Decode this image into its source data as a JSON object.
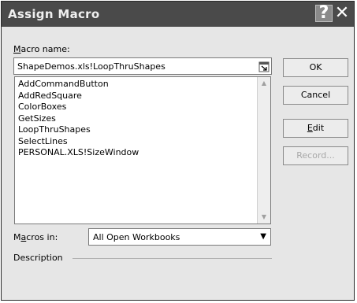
{
  "window": {
    "title": "Assign Macro",
    "help_glyph": "?",
    "close_glyph": "✕"
  },
  "macro_name": {
    "label_prefix": "M",
    "label_rest": "acro name:",
    "value": "ShapeDemos.xls!LoopThruShapes"
  },
  "macro_list": {
    "items": [
      "AddCommandButton",
      "AddRedSquare",
      "ColorBoxes",
      "GetSizes",
      "LoopThruShapes",
      "SelectLines",
      "PERSONAL.XLS!SizeWindow"
    ],
    "scroll_up": "▲",
    "scroll_down": "▼"
  },
  "buttons": {
    "ok": "OK",
    "cancel": "Cancel",
    "edit_prefix": "E",
    "edit_rest": "dit",
    "record": "Record..."
  },
  "macros_in": {
    "label_prefix": "M",
    "label_mid": "a",
    "label_rest": "cros in:",
    "value": "All Open Workbooks",
    "arrow": "▼"
  },
  "description": {
    "label": "Description"
  }
}
